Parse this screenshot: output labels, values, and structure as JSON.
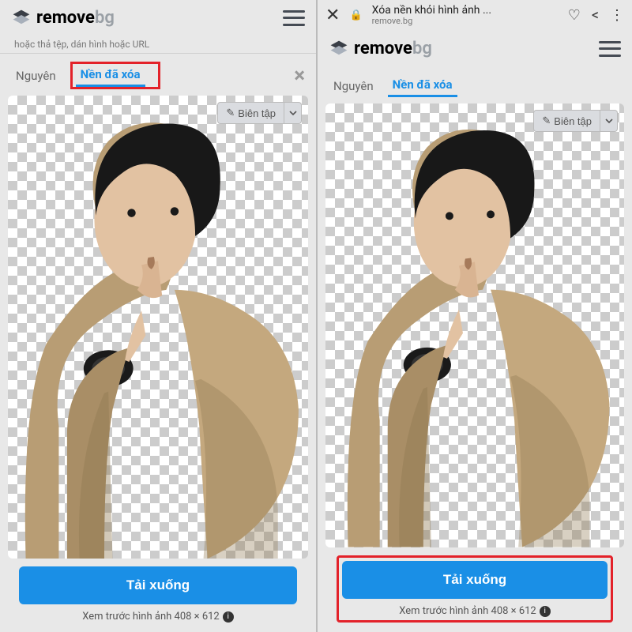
{
  "brand": {
    "name": "remove",
    "suffix": "bg"
  },
  "tabs": {
    "original": "Nguyên",
    "removed": "Nền đã xóa"
  },
  "edit_label": "Biên tập",
  "download_label": "Tải xuống",
  "preview_label": "Xem trước hình ảnh 408 × 612",
  "browser": {
    "title": "Xóa nền khỏi hình ảnh ...",
    "url": "remove.bg"
  },
  "banner_fragment": "hoặc thả tệp, dán hình hoặc URL"
}
